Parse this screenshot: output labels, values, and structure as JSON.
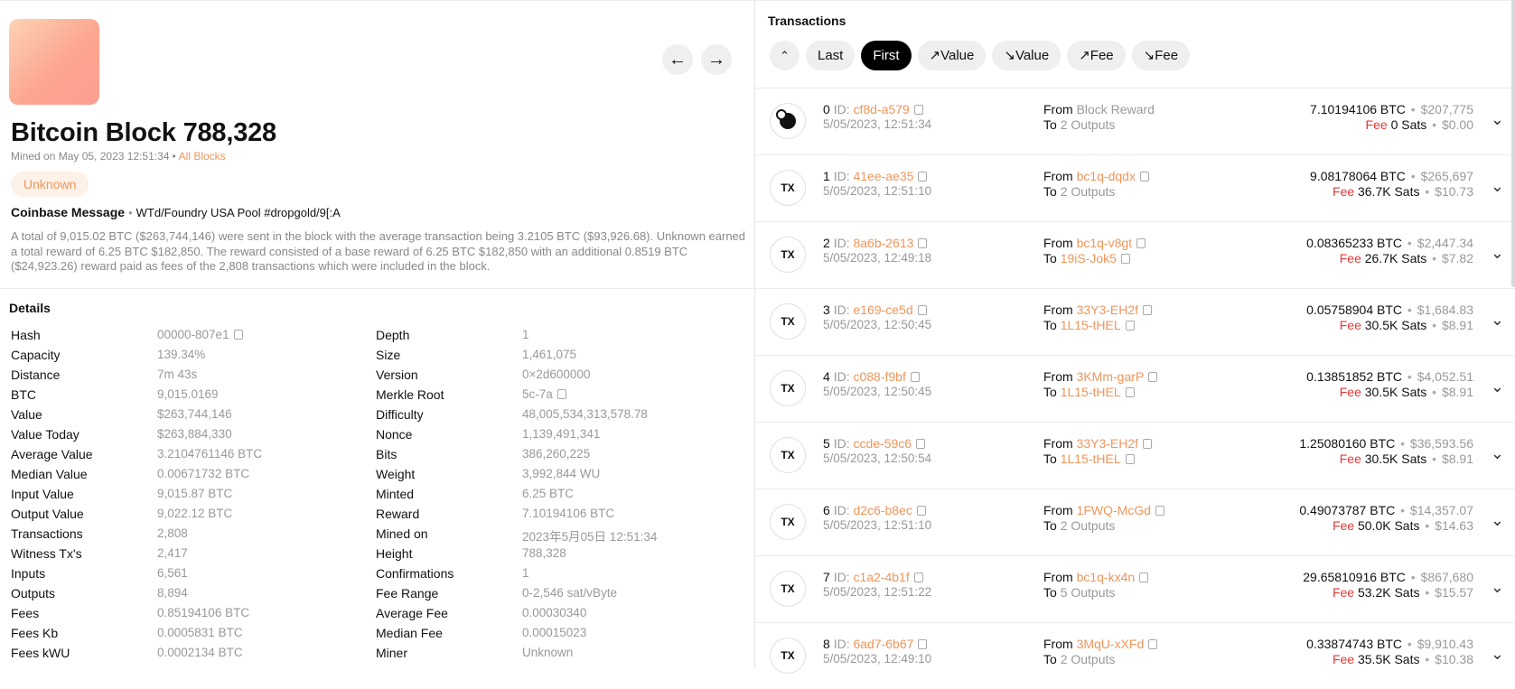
{
  "block": {
    "title_prefix": "Bitcoin Block",
    "number": "788,328",
    "mined_text": "Mined on May 05, 2023 12:51:34",
    "all_blocks_link": "All Blocks",
    "status_pill": "Unknown",
    "coinbase_label": "Coinbase Message",
    "coinbase_message": "WTd/Foundry USA Pool #dropgold/9[:A",
    "summary": "A total of 9,015.02 BTC ($263,744,146) were sent in the block with the average transaction being 3.2105 BTC ($93,926.68). Unknown earned a total reward of 6.25 BTC $182,850. The reward consisted of a base reward of 6.25 BTC $182,850 with an additional 0.8519 BTC ($24,923.26) reward paid as fees of the 2,808 transactions which were included in the block."
  },
  "icons": {
    "prev": "arrow-left-icon",
    "next": "arrow-right-icon",
    "copy": "copy-icon",
    "expand": "chevron-down-icon",
    "sort": "sort-icon"
  },
  "details": {
    "title": "Details",
    "left": [
      {
        "label": "Hash",
        "value": "00000-807e1",
        "copy": true
      },
      {
        "label": "Capacity",
        "value": "139.34%"
      },
      {
        "label": "Distance",
        "value": "7m 43s"
      },
      {
        "label": "BTC",
        "value": "9,015.0169"
      },
      {
        "label": "Value",
        "value": "$263,744,146"
      },
      {
        "label": "Value Today",
        "value": "$263,884,330"
      },
      {
        "label": "Average Value",
        "value": "3.2104761146 BTC"
      },
      {
        "label": "Median Value",
        "value": "0.00671732 BTC"
      },
      {
        "label": "Input Value",
        "value": "9,015.87 BTC"
      },
      {
        "label": "Output Value",
        "value": "9,022.12 BTC"
      },
      {
        "label": "Transactions",
        "value": "2,808"
      },
      {
        "label": "Witness Tx's",
        "value": "2,417"
      },
      {
        "label": "Inputs",
        "value": "6,561"
      },
      {
        "label": "Outputs",
        "value": "8,894"
      },
      {
        "label": "Fees",
        "value": "0.85194106 BTC"
      },
      {
        "label": "Fees Kb",
        "value": "0.0005831 BTC"
      },
      {
        "label": "Fees kWU",
        "value": "0.0002134 BTC"
      }
    ],
    "right": [
      {
        "label": "Depth",
        "value": "1"
      },
      {
        "label": "Size",
        "value": "1,461,075"
      },
      {
        "label": "Version",
        "value": "0×2d600000"
      },
      {
        "label": "Merkle Root",
        "value": "5c-7a",
        "copy": true
      },
      {
        "label": "Difficulty",
        "value": "48,005,534,313,578.78"
      },
      {
        "label": "Nonce",
        "value": "1,139,491,341"
      },
      {
        "label": "Bits",
        "value": "386,260,225"
      },
      {
        "label": "Weight",
        "value": "3,992,844 WU"
      },
      {
        "label": "Minted",
        "value": "6.25 BTC"
      },
      {
        "label": "Reward",
        "value": "7.10194106 BTC"
      },
      {
        "label": "Mined on",
        "value": "2023年5月05日 12:51:34"
      },
      {
        "label": "Height",
        "value": "788,328"
      },
      {
        "label": "Confirmations",
        "value": "1"
      },
      {
        "label": "Fee Range",
        "value": "0-2,546 sat/vByte"
      },
      {
        "label": "Average Fee",
        "value": "0.00030340"
      },
      {
        "label": "Median Fee",
        "value": "0.00015023"
      },
      {
        "label": "Miner",
        "value": "Unknown"
      }
    ]
  },
  "transactions": {
    "title": "Transactions",
    "sort_buttons": [
      {
        "label": "Last",
        "arrow": ""
      },
      {
        "label": "First",
        "arrow": "",
        "active": true
      },
      {
        "label": "Value",
        "arrow": "↗"
      },
      {
        "label": "Value",
        "arrow": "↘"
      },
      {
        "label": "Fee",
        "arrow": "↗"
      },
      {
        "label": "Fee",
        "arrow": "↘"
      }
    ],
    "id_label": "ID:",
    "from_label": "From",
    "to_label": "To",
    "fee_label": "Fee",
    "tx_badge": "TX",
    "rows": [
      {
        "index": "0",
        "id": "cf8d-a579",
        "date": "5/05/2023, 12:51:34",
        "from": "Block Reward",
        "from_link": false,
        "to": "2 Outputs",
        "to_link": false,
        "btc": "7.10194106 BTC",
        "usd": "$207,775",
        "fee_sats": "0 Sats",
        "fee_usd": "$0.00",
        "coinbase": true
      },
      {
        "index": "1",
        "id": "41ee-ae35",
        "date": "5/05/2023, 12:51:10",
        "from": "bc1q-dqdx",
        "from_link": true,
        "to": "2 Outputs",
        "to_link": false,
        "btc": "9.08178064 BTC",
        "usd": "$265,697",
        "fee_sats": "36.7K Sats",
        "fee_usd": "$10.73"
      },
      {
        "index": "2",
        "id": "8a6b-2613",
        "date": "5/05/2023, 12:49:18",
        "from": "bc1q-v8gt",
        "from_link": true,
        "to": "19iS-Jok5",
        "to_link": true,
        "btc": "0.08365233 BTC",
        "usd": "$2,447.34",
        "fee_sats": "26.7K Sats",
        "fee_usd": "$7.82"
      },
      {
        "index": "3",
        "id": "e169-ce5d",
        "date": "5/05/2023, 12:50:45",
        "from": "33Y3-EH2f",
        "from_link": true,
        "to": "1L15-tHEL",
        "to_link": true,
        "btc": "0.05758904 BTC",
        "usd": "$1,684.83",
        "fee_sats": "30.5K Sats",
        "fee_usd": "$8.91"
      },
      {
        "index": "4",
        "id": "c088-f9bf",
        "date": "5/05/2023, 12:50:45",
        "from": "3KMm-garP",
        "from_link": true,
        "to": "1L15-tHEL",
        "to_link": true,
        "btc": "0.13851852 BTC",
        "usd": "$4,052.51",
        "fee_sats": "30.5K Sats",
        "fee_usd": "$8.91"
      },
      {
        "index": "5",
        "id": "ccde-59c6",
        "date": "5/05/2023, 12:50:54",
        "from": "33Y3-EH2f",
        "from_link": true,
        "to": "1L15-tHEL",
        "to_link": true,
        "btc": "1.25080160 BTC",
        "usd": "$36,593.56",
        "fee_sats": "30.5K Sats",
        "fee_usd": "$8.91"
      },
      {
        "index": "6",
        "id": "d2c6-b8ec",
        "date": "5/05/2023, 12:51:10",
        "from": "1FWQ-McGd",
        "from_link": true,
        "to": "2 Outputs",
        "to_link": false,
        "btc": "0.49073787 BTC",
        "usd": "$14,357.07",
        "fee_sats": "50.0K Sats",
        "fee_usd": "$14.63"
      },
      {
        "index": "7",
        "id": "c1a2-4b1f",
        "date": "5/05/2023, 12:51:22",
        "from": "bc1q-kx4n",
        "from_link": true,
        "to": "5 Outputs",
        "to_link": false,
        "btc": "29.65810916 BTC",
        "usd": "$867,680",
        "fee_sats": "53.2K Sats",
        "fee_usd": "$15.57"
      },
      {
        "index": "8",
        "id": "6ad7-6b67",
        "date": "5/05/2023, 12:49:10",
        "from": "3MqU-xXFd",
        "from_link": true,
        "to": "2 Outputs",
        "to_link": false,
        "btc": "0.33874743 BTC",
        "usd": "$9,910.43",
        "fee_sats": "35.5K Sats",
        "fee_usd": "$10.38"
      }
    ]
  },
  "colors": {
    "accent": "#f0955a",
    "fee_red": "#e53935",
    "muted": "#999999"
  }
}
